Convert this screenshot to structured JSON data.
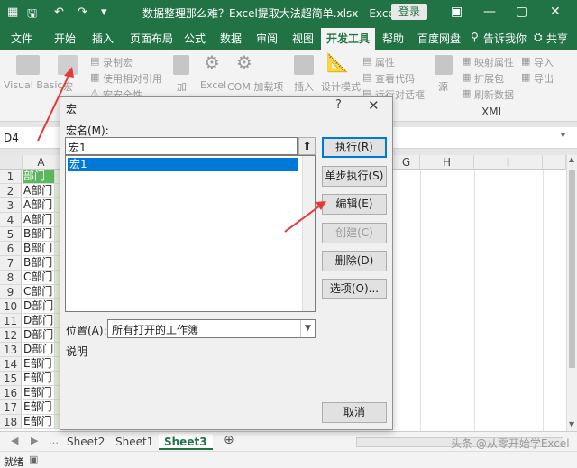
{
  "titlebar": {
    "title": "数据整理那么难？Excel提取大法超简单.xlsx  -  Excel",
    "login": "登录",
    "icons": [
      "save-icon",
      "undo-icon",
      "redo-icon",
      "customize-icon"
    ]
  },
  "tabs": [
    "文件",
    "开始",
    "插入",
    "页面布局",
    "公式",
    "数据",
    "审阅",
    "视图",
    "开发工具",
    "帮助",
    "百度网盘",
    "告诉我你",
    "共享"
  ],
  "ribbon": {
    "visual_basic": "Visual Basic",
    "macro": "宏",
    "record_macro": "录制宏",
    "relative_ref": "使用相对引用",
    "macro_security": "宏安全性",
    "add_ins": "加",
    "excel_addins": "Excel",
    "com_addins": "COM 加载项",
    "insert": "插入",
    "design_mode": "设计模式",
    "properties": "属性",
    "view_code": "查看代码",
    "run_dialog": "运行对话框",
    "source": "源",
    "map_props": "映射属性",
    "expansion": "扩展包",
    "refresh_data": "刷新数据",
    "import": "导入",
    "export": "导出",
    "xml": "XML"
  },
  "formula_bar": {
    "name_box": "D4"
  },
  "columns": [
    "A",
    "G",
    "H",
    "I"
  ],
  "rows": [
    {
      "n": "1",
      "a": "部门"
    },
    {
      "n": "2",
      "a": "A部门"
    },
    {
      "n": "3",
      "a": "A部门"
    },
    {
      "n": "4",
      "a": "A部门"
    },
    {
      "n": "5",
      "a": "B部门"
    },
    {
      "n": "6",
      "a": "B部门"
    },
    {
      "n": "7",
      "a": "B部门"
    },
    {
      "n": "8",
      "a": "C部门"
    },
    {
      "n": "9",
      "a": "C部门"
    },
    {
      "n": "10",
      "a": "D部门"
    },
    {
      "n": "11",
      "a": "D部门"
    },
    {
      "n": "12",
      "a": "D部门"
    },
    {
      "n": "13",
      "a": "D部门"
    },
    {
      "n": "14",
      "a": "E部门"
    },
    {
      "n": "15",
      "a": "E部门"
    },
    {
      "n": "16",
      "a": "E部门"
    },
    {
      "n": "17",
      "a": "E部门"
    },
    {
      "n": "18",
      "a": "E部门"
    }
  ],
  "sheets": [
    "Sheet2",
    "Sheet1",
    "Sheet3"
  ],
  "status": {
    "ready": "就绪"
  },
  "dialog": {
    "title": "宏",
    "help": "?",
    "close": "✕",
    "macro_name_label": "宏名(M):",
    "macro_name_value": "宏1",
    "macros": [
      "宏1"
    ],
    "buttons": {
      "run": "执行(R)",
      "step_into": "单步执行(S)",
      "edit": "编辑(E)",
      "create": "创建(C)",
      "delete": "删除(D)",
      "options": "选项(O)...",
      "cancel": "取消"
    },
    "location_label": "位置(A):",
    "location_value": "所有打开的工作簿",
    "description_label": "说明"
  },
  "watermark": "头条 @从零开始学Excel",
  "colors": {
    "excel_green": "#217346",
    "header_cell": "#5cb85c",
    "selection_blue": "#0078d7",
    "annotation_red": "#e53935"
  }
}
